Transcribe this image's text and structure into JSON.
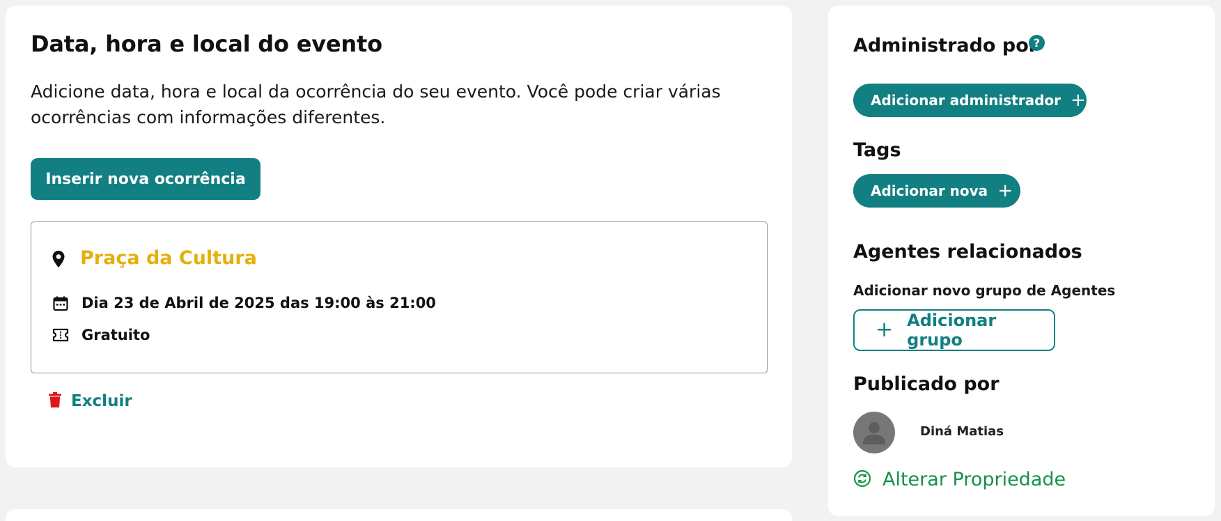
{
  "event_section": {
    "title": "Data, hora e local do evento",
    "description": "Adicione data, hora e local da ocorrência do seu evento. Você pode criar várias ocorrências com informações diferentes.",
    "insert_button_label": "Inserir nova ocorrência",
    "occurrence": {
      "place": "Praça da Cultura",
      "datetime": "Dia 23 de Abril de 2025 das 19:00 às 21:00",
      "price": "Gratuito"
    },
    "delete_label": "Excluir"
  },
  "sidebar": {
    "admin_title": "Administrado por",
    "help_glyph": "?",
    "add_admin_label": "Adicionar administrador",
    "tags_title": "Tags",
    "add_tag_label": "Adicionar nova",
    "agents_title": "Agentes relacionados",
    "agents_subtitle": "Adicionar novo grupo de Agentes",
    "add_group_label": "Adicionar grupo",
    "published_title": "Publicado por",
    "publisher_name": "Diná Matias",
    "change_owner_label": "Alterar Propriedade"
  },
  "icons": {
    "plus": "+",
    "pin": "map-pin-icon",
    "calendar": "calendar-icon",
    "ticket": "ticket-icon",
    "trash": "trash-icon",
    "swap": "swap-icon",
    "user": "user-icon"
  },
  "colors": {
    "teal": "#127f82",
    "place_yellow": "#e4b00d",
    "delete_red": "#e0161e",
    "green": "#16914a",
    "page_bg": "#f2f2f2"
  }
}
